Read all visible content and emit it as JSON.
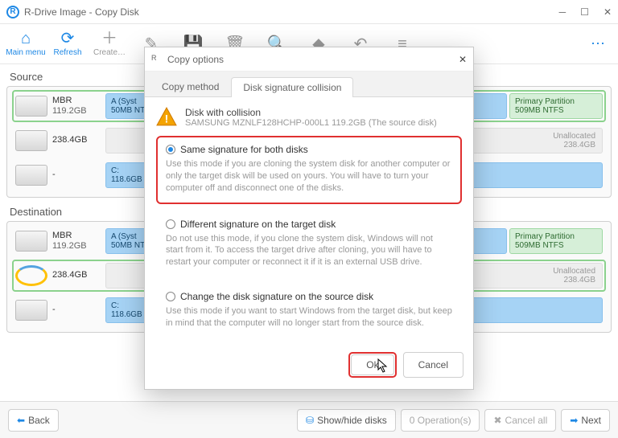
{
  "window": {
    "title": "R-Drive Image - Copy Disk"
  },
  "toolbar": {
    "main_menu": "Main menu",
    "refresh": "Refresh",
    "create": "Create…"
  },
  "source": {
    "label": "Source",
    "disk1": {
      "name": "MBR",
      "size": "119.2GB",
      "p1": {
        "top": "A (Syst",
        "bot": "50MB NT"
      },
      "p2": {
        "top": "Primary Partition",
        "bot": "509MB NTFS"
      }
    },
    "disk2": {
      "name": "238.4GB",
      "unalloc_top": "Unallocated",
      "unalloc_bot": "238.4GB"
    },
    "disk3": {
      "name": "-",
      "p1": {
        "top": "C:",
        "bot": "118.6GB"
      }
    }
  },
  "destination": {
    "label": "Destination",
    "disk1": {
      "name": "MBR",
      "size": "119.2GB",
      "p1": {
        "top": "A (Syst",
        "bot": "50MB NT"
      },
      "p2": {
        "top": "Primary Partition",
        "bot": "509MB NTFS"
      }
    },
    "disk2": {
      "name": "238.4GB",
      "unalloc_top": "Unallocated",
      "unalloc_bot": "238.4GB"
    },
    "disk3": {
      "name": "-",
      "p1": {
        "top": "C:",
        "bot": "118.6GB"
      }
    }
  },
  "footer": {
    "back": "Back",
    "showhide": "Show/hide disks",
    "ops": "0 Operation(s)",
    "cancel_all": "Cancel all",
    "next": "Next"
  },
  "modal": {
    "title": "Copy options",
    "tab1": "Copy method",
    "tab2": "Disk signature collision",
    "warn_title": "Disk with collision",
    "warn_sub": "SAMSUNG MZNLF128HCHP-000L1 119.2GB (The source disk)",
    "opt1_title": "Same signature for both disks",
    "opt1_desc": "Use this mode if you are cloning the system disk for another computer or only the target disk will be used on yours. You will have to turn your computer off and disconnect one of the disks.",
    "opt2_title": "Different signature on the target disk",
    "opt2_desc": "Do not use this mode, if you clone the system disk, Windows will not start from it. To access the target drive after cloning, you will have to restart your computer or reconnect it if it is an external USB drive.",
    "opt3_title": "Change the disk signature on the source disk",
    "opt3_desc": "Use this mode if you want to start Windows from the target disk, but keep in mind that the computer will no longer start from the source disk.",
    "ok": "Ok",
    "cancel": "Cancel"
  }
}
